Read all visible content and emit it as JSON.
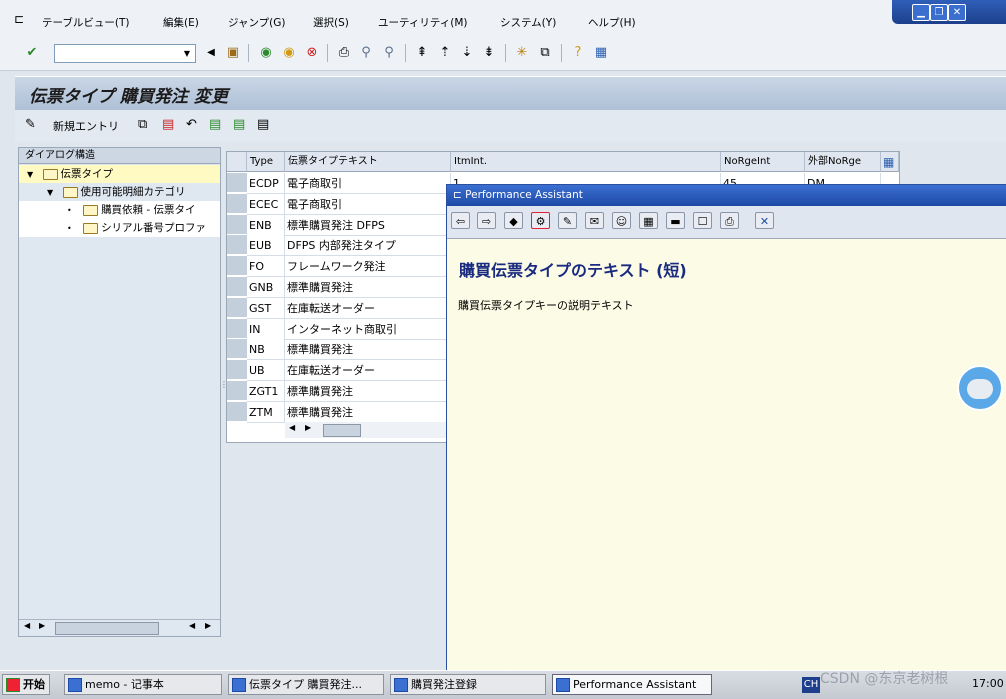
{
  "menubar": {
    "items": [
      "テーブルビュー(T)",
      "編集(E)",
      "ジャンプ(G)",
      "選択(S)",
      "ユーティリティ(M)",
      "システム(Y)",
      "ヘルプ(H)"
    ]
  },
  "window_controls": {
    "minimize": "▁",
    "restore": "❐",
    "close": "✕"
  },
  "toolbar": {
    "command_value": ""
  },
  "title": "伝票タイプ 購買発注 変更",
  "app_toolbar": {
    "new_entries_label": "新規エントリ"
  },
  "tree": {
    "header": "ダイアログ構造",
    "nodes": [
      {
        "label": "伝票タイプ",
        "level": 0,
        "expanded": true,
        "selected": true
      },
      {
        "label": "使用可能明細カテゴリ",
        "level": 1,
        "expanded": true,
        "selected": false
      },
      {
        "label": "購買依頼 - 伝票タイ",
        "level": 2,
        "expanded": false,
        "selected": false
      },
      {
        "label": "シリアル番号プロファ",
        "level": 2,
        "expanded": false,
        "selected": false
      }
    ]
  },
  "table": {
    "columns": [
      "Type",
      "伝票タイプテキスト",
      "ItmInt.",
      "NoRgeInt",
      "外部NoRge"
    ],
    "rows": [
      {
        "type": "ECDP",
        "text": "電子商取引",
        "itm": "1",
        "norge": "45",
        "ext": "DM"
      },
      {
        "type": "ECEC",
        "text": "電子商取引",
        "itm": "",
        "norge": "",
        "ext": ""
      },
      {
        "type": "ENB",
        "text": "標準購買発注 DFPS",
        "itm": "",
        "norge": "",
        "ext": ""
      },
      {
        "type": "EUB",
        "text": "DFPS 内部発注タイプ",
        "itm": "",
        "norge": "",
        "ext": ""
      },
      {
        "type": "FO",
        "text": "フレームワーク発注",
        "itm": "",
        "norge": "",
        "ext": ""
      },
      {
        "type": "GNB",
        "text": "標準購買発注",
        "itm": "",
        "norge": "",
        "ext": ""
      },
      {
        "type": "GST",
        "text": "在庫転送オーダー",
        "itm": "",
        "norge": "",
        "ext": ""
      },
      {
        "type": "IN",
        "text": "インターネット商取引",
        "itm": "",
        "norge": "",
        "ext": ""
      },
      {
        "type": "NB",
        "text": "標準購買発注",
        "itm": "",
        "norge": "",
        "ext": ""
      },
      {
        "type": "UB",
        "text": "在庫転送オーダー",
        "itm": "",
        "norge": "",
        "ext": ""
      },
      {
        "type": "ZGT1",
        "text": "標準購買発注",
        "itm": "",
        "norge": "",
        "ext": ""
      },
      {
        "type": "ZTM",
        "text": "標準購買発注",
        "itm": "",
        "norge": "",
        "ext": ""
      }
    ]
  },
  "performance_assistant": {
    "title": "Performance Assistant",
    "heading": "購買伝票タイプのテキスト (短)",
    "body": "購買伝票タイプキーの説明テキスト"
  },
  "taskbar": {
    "start": "开始",
    "tasks": [
      "memo - 记事本",
      "伝票タイプ 購買発注...",
      "購買発注登録",
      "Performance Assistant"
    ],
    "lang": "CH",
    "clock": "17:00",
    "watermark": "CSDN @东京老树根"
  },
  "colors": {
    "accent": "#1d4aa6",
    "title_bg": "#aec0d6",
    "pa_bg": "#fbfbe6"
  }
}
